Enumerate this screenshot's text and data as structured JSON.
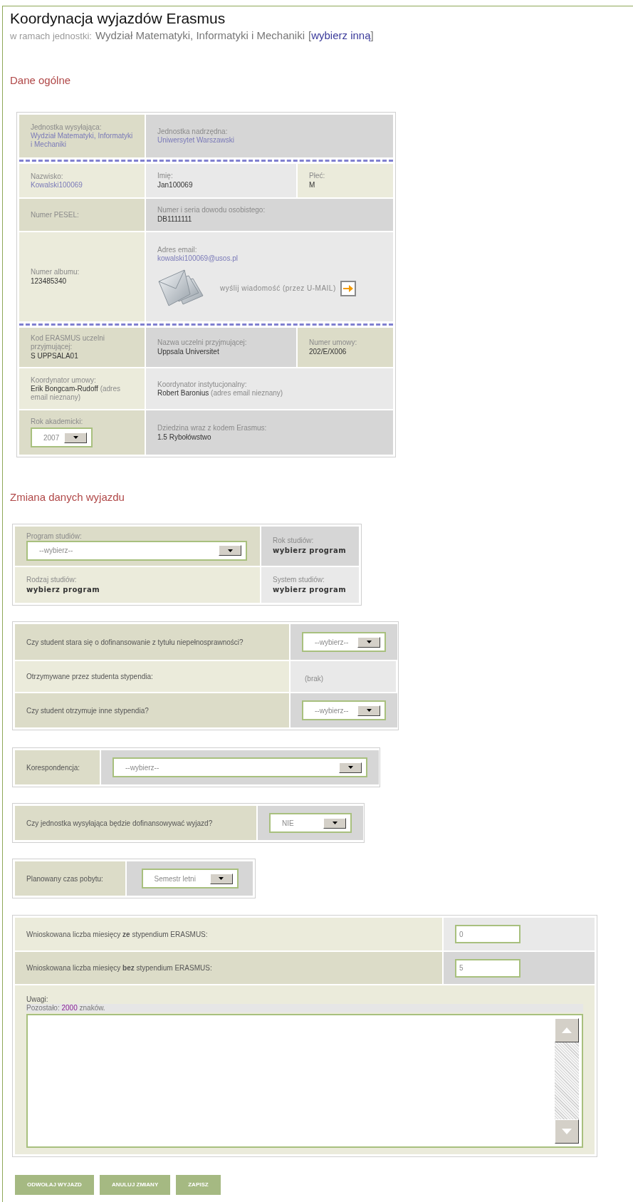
{
  "header": {
    "title": "Koordynacja wyjazdów Erasmus",
    "unit_label": "w ramach jednostki:",
    "unit_name": "Wydział Matematyki, Informatyki i Mechaniki",
    "bracket_open": "[",
    "change_link": "wybierz inną",
    "bracket_close": "]"
  },
  "general": {
    "title": "Dane ogólne",
    "groups": [
      [
        {
          "cells": [
            {
              "kind": "link",
              "label": "Jednostka wysyłająca:",
              "value": "Wydział Matematyki, Informatyki i Mechaniki"
            },
            {
              "kind": "link",
              "label": "Jednostka nadrzędna:",
              "value": "Uniwersytet Warszawski"
            }
          ]
        }
      ],
      [
        {
          "cells": [
            {
              "kind": "link",
              "label": "Nazwisko:",
              "value": "Kowalski100069"
            },
            {
              "kind": "text",
              "label": "Imię:",
              "value": "Jan100069"
            },
            {
              "kind": "text",
              "label": "Płeć:",
              "value": "M"
            }
          ]
        },
        {
          "cells": [
            {
              "kind": "text",
              "label": "Numer PESEL:"
            },
            {
              "kind": "text",
              "label": "Numer i seria dowodu osobistego:",
              "value": "DB1111111"
            }
          ]
        },
        {
          "cells": [
            {
              "kind": "text",
              "label": "Numer albumu:",
              "value": "123485340"
            },
            {
              "kind": "mail",
              "label": "Adres email:",
              "value": "kowalski100069@usos.pl",
              "send_label": "wyślij wiadomość (przez U-MAIL)"
            }
          ]
        }
      ],
      [
        {
          "cells": [
            {
              "kind": "text",
              "label": "Kod ERASMUS uczelni przyjmującej:",
              "value": "S UPPSALA01"
            },
            {
              "kind": "text",
              "label": "Nazwa uczelni przyjmującej:",
              "value": "Uppsala Universitet"
            },
            {
              "kind": "text",
              "label": "Numer umowy:",
              "value": "202/E/X006"
            }
          ]
        },
        {
          "cells": [
            {
              "kind": "person",
              "label": "Koordynator umowy:",
              "value": "Erik Bongcam-Rudoff",
              "note": "(adres email nieznany)"
            },
            {
              "kind": "person",
              "label": "Koordynator instytucjonalny:",
              "value": "Robert Baronius",
              "note": "(adres email nieznany)"
            }
          ]
        },
        {
          "cells": [
            {
              "kind": "select",
              "label": "Rok akademicki:",
              "value": "2007"
            },
            {
              "kind": "text",
              "label": "Dziedzina wraz z kodem Erasmus:",
              "value": "1.5 Rybołówstwo"
            }
          ]
        }
      ]
    ]
  },
  "trip": {
    "title": "Zmiana danych wyjazdu",
    "forms": [
      {
        "rows": [
          {
            "cells": [
              {
                "kind": "select",
                "label": "Program studiów:",
                "value": "--wybierz--"
              },
              {
                "kind": "bold",
                "label": "Rok studiów:",
                "value": "wybierz program"
              }
            ]
          },
          {
            "cells": [
              {
                "kind": "bold",
                "label": "Rodzaj studiów:",
                "value": "wybierz program"
              },
              {
                "kind": "bold",
                "label": "System studiów:",
                "value": "wybierz program"
              }
            ]
          }
        ]
      },
      {
        "rows": [
          {
            "cells": [
              {
                "kind": "question",
                "text": "Czy student stara się o dofinansowanie z tytułu niepełnosprawności?"
              },
              {
                "kind": "select",
                "value": "--wybierz--"
              }
            ]
          },
          {
            "cells": [
              {
                "kind": "question",
                "text": "Otrzymywane przez studenta stypendia:"
              },
              {
                "kind": "muted",
                "text": "(brak)"
              }
            ]
          },
          {
            "cells": [
              {
                "kind": "question",
                "text": "Czy student otrzymuje inne stypendia?"
              },
              {
                "kind": "select",
                "value": "--wybierz--"
              }
            ]
          }
        ]
      },
      {
        "rows": [
          {
            "cells": [
              {
                "kind": "question",
                "text": "Korespondencja:"
              },
              {
                "kind": "select",
                "value": "--wybierz--"
              }
            ]
          }
        ]
      },
      {
        "rows": [
          {
            "cells": [
              {
                "kind": "question",
                "text": "Czy jednostka wysyłająca będzie dofinansowywać wyjazd?"
              },
              {
                "kind": "select",
                "value": "NIE"
              }
            ]
          }
        ]
      },
      {
        "rows": [
          {
            "cells": [
              {
                "kind": "question",
                "text": "Planowany czas pobytu:"
              },
              {
                "kind": "select",
                "value": "Semestr letni"
              }
            ]
          }
        ]
      },
      {
        "rows": [
          {
            "cells": [
              {
                "kind": "question",
                "text": "Wnioskowana liczba miesięcy **ze** stypendium ERASMUS:"
              },
              {
                "kind": "input",
                "value": "0"
              }
            ]
          },
          {
            "cells": [
              {
                "kind": "question",
                "text": "Wnioskowana liczba miesięcy **bez** stypendium ERASMUS:"
              },
              {
                "kind": "input",
                "value": "5"
              }
            ]
          },
          {
            "cells": [
              {
                "kind": "remarks",
                "label": "Uwagi:",
                "counter_prefix": "Pozostało:",
                "counter_value": "2000",
                "counter_suffix": "znaków."
              }
            ]
          }
        ]
      }
    ]
  },
  "buttons": [
    "ODWOŁAJ WYJAZD",
    "ANULUJ ZMIANY",
    "ZAPISZ"
  ]
}
